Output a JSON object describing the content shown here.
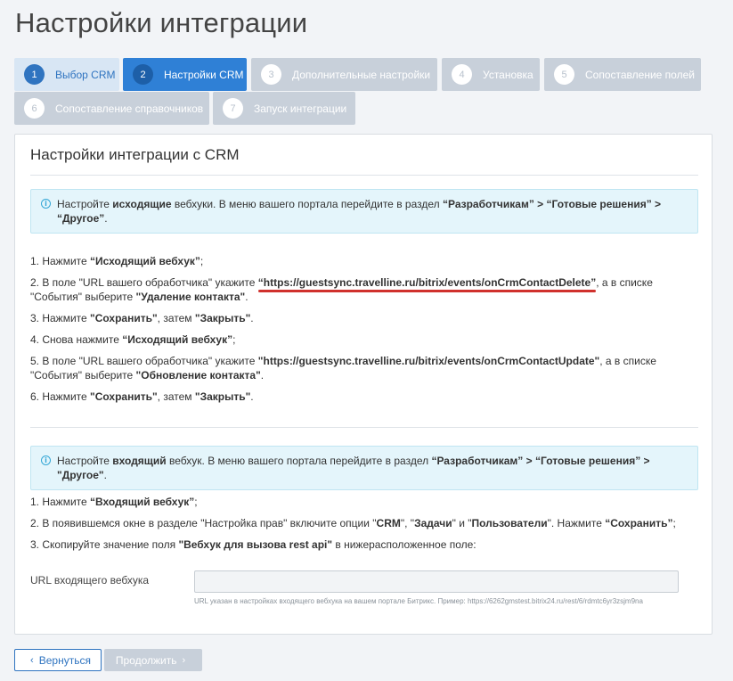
{
  "page": {
    "title": "Настройки интеграции"
  },
  "wizard": {
    "steps": [
      {
        "num": "1",
        "label": "Выбор CRM",
        "state": "visited"
      },
      {
        "num": "2",
        "label": "Настройки CRM",
        "state": "active"
      },
      {
        "num": "3",
        "label": "Дополнительные настройки",
        "state": "inactive"
      },
      {
        "num": "4",
        "label": "Установка",
        "state": "inactive"
      },
      {
        "num": "5",
        "label": "Сопоставление полей",
        "state": "inactive"
      },
      {
        "num": "6",
        "label": "Сопоставление справочников",
        "state": "inactive"
      },
      {
        "num": "7",
        "label": "Запуск интеграции",
        "state": "inactive"
      }
    ]
  },
  "panel": {
    "title": "Настройки интеграции с CRM",
    "outgoing": {
      "alert": {
        "t1": "Настройте ",
        "b1": "исходящие",
        "t2": " вебхуки. В меню вашего портала перейдите в раздел ",
        "b2": "“Разработчикам” > “Готовые решения” > “Другое”",
        "t3": "."
      },
      "s1": {
        "pre": "1. Нажмите ",
        "b1": "“Исходящий вебхук”",
        "post": ";"
      },
      "s2": {
        "pre": "2. В поле \"URL вашего обработчика\" укажите ",
        "url": "“https://guestsync.travelline.ru/bitrix/events/onCrmContactDelete”",
        "mid": ", а в списке \"События\" выберите ",
        "b2": "\"Удаление контакта\"",
        "post": "."
      },
      "s3": {
        "pre": "3. Нажмите ",
        "b1": "\"Сохранить\"",
        "mid": ", затем ",
        "b2": "\"Закрыть\"",
        "post": "."
      },
      "s4": {
        "pre": "4. Снова нажмите ",
        "b1": "“Исходящий вебхук”",
        "post": ";"
      },
      "s5": {
        "pre": "5. В поле \"URL вашего обработчика\" укажите ",
        "url": "\"https://guestsync.travelline.ru/bitrix/events/onCrmContactUpdate\"",
        "mid": ", а в списке \"События\" выберите ",
        "b2": "\"Обновление контакта\"",
        "post": "."
      },
      "s6": {
        "pre": "6. Нажмите ",
        "b1": "\"Сохранить\"",
        "mid": ", затем ",
        "b2": "\"Закрыть\"",
        "post": "."
      }
    },
    "incoming": {
      "alert": {
        "t1": "Настройте ",
        "b1": "входящий",
        "t2": " вебхук. В меню вашего портала перейдите в раздел ",
        "b2": "“Разработчикам” > “Готовые решения” > \"Другое\"",
        "t3": "."
      },
      "s1": {
        "pre": "1. Нажмите ",
        "b1": "“Входящий вебхук”",
        "post": ";"
      },
      "s2": {
        "pre": "2. В появившемся окне в разделе \"Настройка прав\" включите опции \"",
        "b1": "CRM",
        "m1": "\", \"",
        "b2": "Задачи",
        "m2": "\" и \"",
        "b3": "Пользователи",
        "m3": "\". Нажмите ",
        "b4": "“Сохранить”",
        "post": ";"
      },
      "s3": {
        "pre": "3. Скопируйте значение поля ",
        "b1": "\"Вебхук для вызова rest api\"",
        "post": " в нижерасположенное поле:"
      }
    },
    "field": {
      "label": "URL входящего вебхука",
      "value": "",
      "hint": "URL указан в настройках входящего вебхука на вашем портале Битрикс. Пример: https://6262gmstest.bitrix24.ru/rest/6/rdmtc6yr3zsjm9na"
    }
  },
  "footer": {
    "back_label": "Вернуться",
    "next_label": "Продолжить"
  },
  "colors": {
    "accent": "#2f80d6",
    "visited_bg": "#d8e6f4",
    "inactive_bg": "#c8d0da",
    "alert_bg": "#e4f5fb",
    "underline": "#d0312d"
  }
}
